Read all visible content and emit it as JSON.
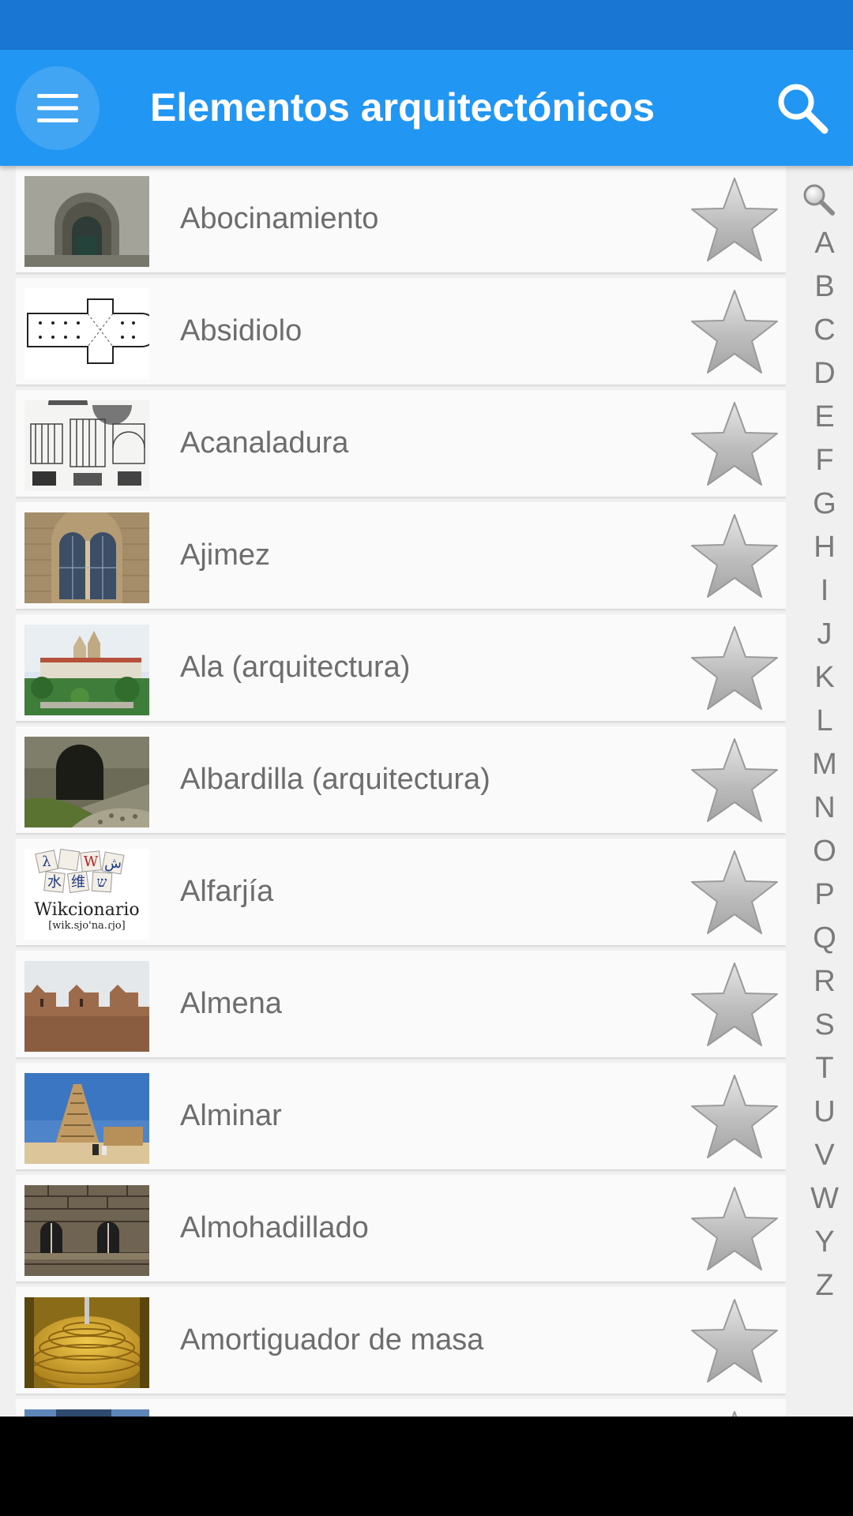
{
  "app_bar": {
    "title": "Elementos arquitectónicos",
    "color": "#2196f3",
    "status_bar_color": "#1976d2",
    "menu_icon": "hamburger-menu-icon",
    "search_icon": "search-icon"
  },
  "list": {
    "items": [
      {
        "label": "Abocinamiento",
        "thumb": "church-portal",
        "favorite": false
      },
      {
        "label": "Absidiolo",
        "thumb": "floor-plan",
        "favorite": false
      },
      {
        "label": "Acanaladura",
        "thumb": "column-drawings",
        "favorite": false
      },
      {
        "label": "Ajimez",
        "thumb": "twin-window",
        "favorite": false
      },
      {
        "label": "Ala (arquitectura)",
        "thumb": "monastery",
        "favorite": false
      },
      {
        "label": "Albardilla (arquitectura)",
        "thumb": "stone-arch",
        "favorite": false
      },
      {
        "label": "Alfarjía",
        "thumb": "wiktionary-logo",
        "favorite": false
      },
      {
        "label": "Almena",
        "thumb": "battlements",
        "favorite": false
      },
      {
        "label": "Alminar",
        "thumb": "mud-minaret",
        "favorite": false
      },
      {
        "label": "Almohadillado",
        "thumb": "rusticated-facade",
        "favorite": false
      },
      {
        "label": "Amortiguador de masa",
        "thumb": "tuned-mass-damper",
        "favorite": false
      }
    ]
  },
  "index_bar": {
    "search_icon": "magnifier-icon",
    "letters": [
      "A",
      "B",
      "C",
      "D",
      "E",
      "F",
      "G",
      "H",
      "I",
      "J",
      "K",
      "L",
      "M",
      "N",
      "O",
      "P",
      "Q",
      "R",
      "S",
      "T",
      "U",
      "V",
      "W",
      "Y",
      "Z"
    ]
  },
  "thumbnails": {
    "wiktionary_logo_text": "Wikcionario",
    "wiktionary_ipa_text": "[wik.sjo'na.ɾjo]"
  }
}
